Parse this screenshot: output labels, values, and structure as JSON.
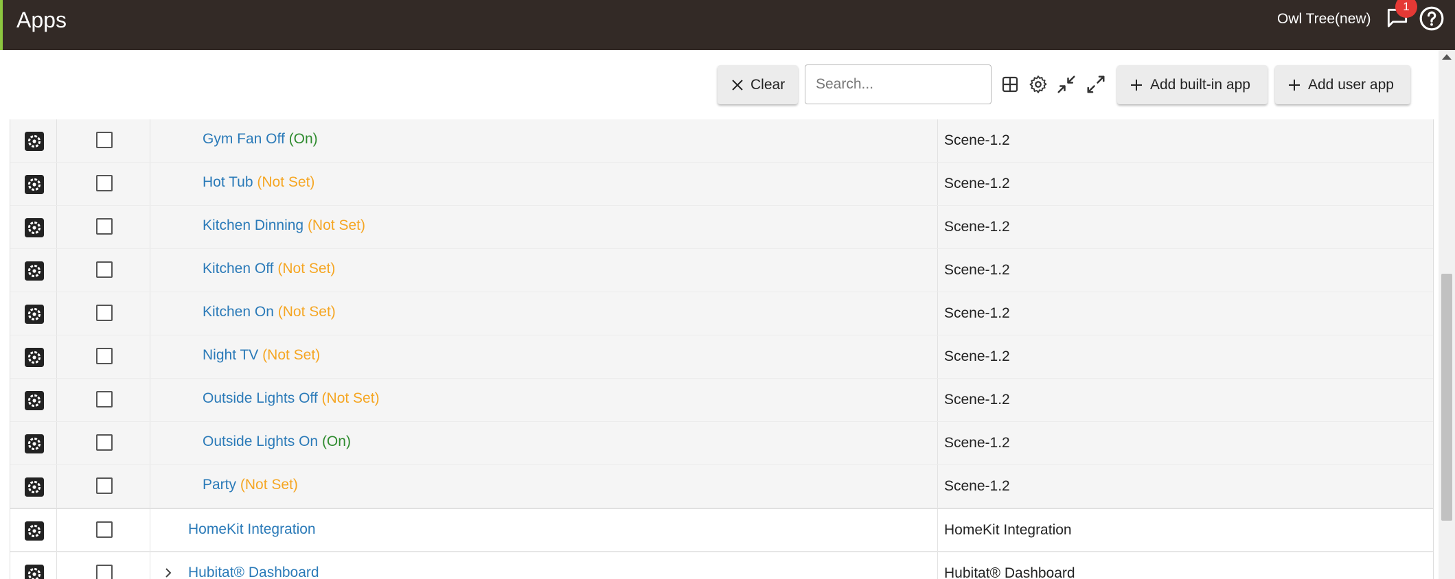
{
  "header": {
    "title": "Apps",
    "hub_name": "Owl Tree(new)",
    "notification_count": "1"
  },
  "toolbar": {
    "clear_label": "Clear",
    "search_placeholder": "Search...",
    "add_builtin_label": "Add built-in app",
    "add_user_label": "Add user app"
  },
  "rows": [
    {
      "name": "Gym Fan Off",
      "status": "(On)",
      "type": "Scene-1.2"
    },
    {
      "name": "Hot Tub",
      "status": "(Not Set)",
      "type": "Scene-1.2"
    },
    {
      "name": "Kitchen Dinning",
      "status": "(Not Set)",
      "type": "Scene-1.2"
    },
    {
      "name": "Kitchen Off",
      "status": "(Not Set)",
      "type": "Scene-1.2"
    },
    {
      "name": "Kitchen On",
      "status": "(Not Set)",
      "type": "Scene-1.2"
    },
    {
      "name": "Night TV",
      "status": "(Not Set)",
      "type": "Scene-1.2"
    },
    {
      "name": "Outside Lights Off",
      "status": "(Not Set)",
      "type": "Scene-1.2"
    },
    {
      "name": "Outside Lights On",
      "status": "(On)",
      "type": "Scene-1.2"
    },
    {
      "name": "Party",
      "status": "(Not Set)",
      "type": "Scene-1.2"
    },
    {
      "name": "HomeKit Integration",
      "status": "",
      "type": "HomeKit Integration"
    },
    {
      "name": "Hubitat® Dashboard",
      "status": "",
      "type": "Hubitat® Dashboard"
    }
  ],
  "colors": {
    "header_bg": "#332a26",
    "accent": "#8cc63f",
    "link": "#2a7ab8",
    "status_on": "#2e8b2e",
    "status_not_set": "#f5a623",
    "badge": "#e53935"
  }
}
